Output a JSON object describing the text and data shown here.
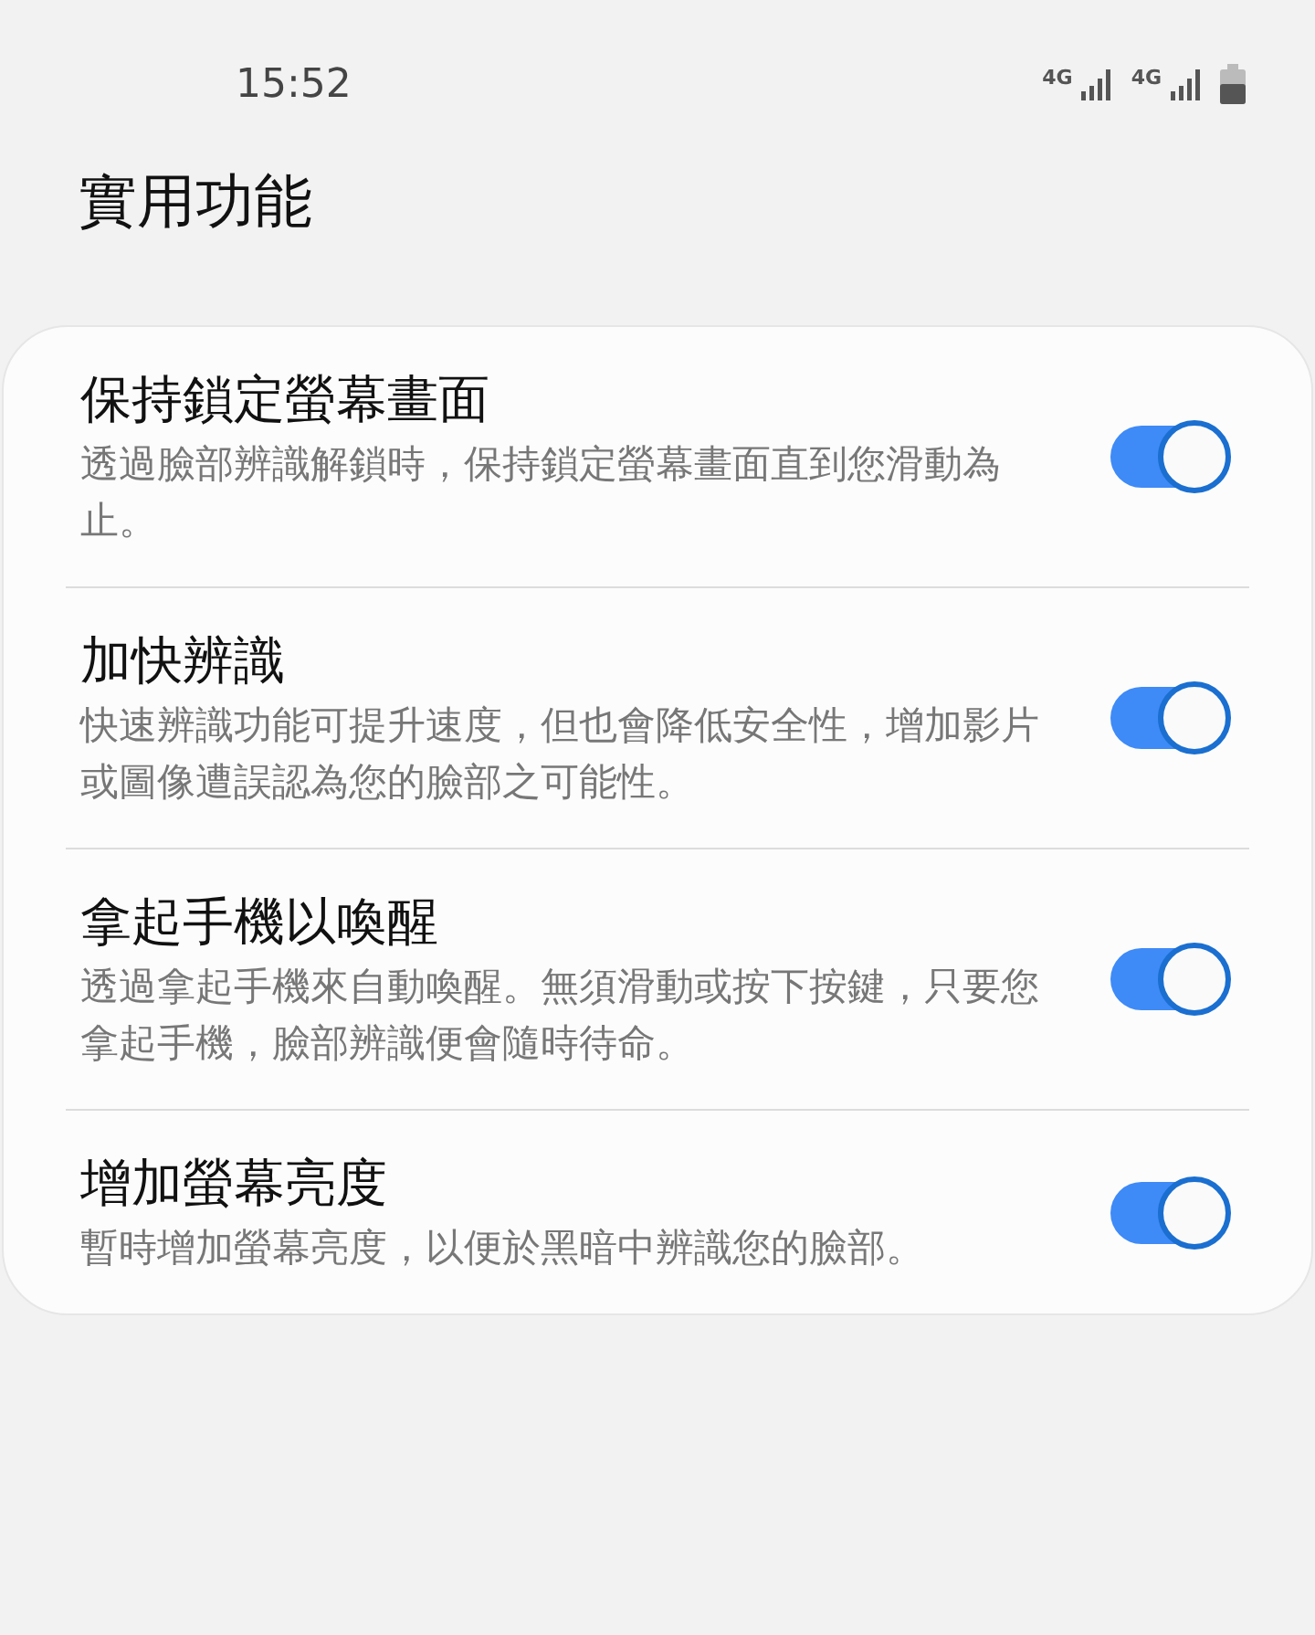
{
  "status_bar": {
    "time": "15:52",
    "network_1": "4G",
    "network_2": "4G"
  },
  "title": "實用功能",
  "settings": [
    {
      "title": "保持鎖定螢幕畫面",
      "description": "透過臉部辨識解鎖時，保持鎖定螢幕畫面直到您滑動為止。",
      "on": true
    },
    {
      "title": "加快辨識",
      "description": "快速辨識功能可提升速度，但也會降低安全性，增加影片或圖像遭誤認為您的臉部之可能性。",
      "on": true
    },
    {
      "title": "拿起手機以喚醒",
      "description": "透過拿起手機來自動喚醒。無須滑動或按下按鍵，只要您拿起手機，臉部辨識便會隨時待命。",
      "on": true
    },
    {
      "title": "增加螢幕亮度",
      "description": "暫時增加螢幕亮度，以便於黑暗中辨識您的臉部。",
      "on": true
    }
  ]
}
